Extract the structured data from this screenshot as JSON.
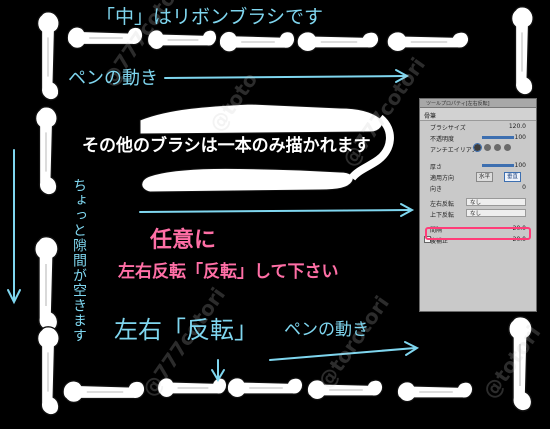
{
  "texts": {
    "title_line": "「中」はリボンブラシです",
    "pen_motion_top": "ペンの動き",
    "other_brush": "その他のブラシは一本のみ描かれます",
    "gap_note": "ちょっと隙間が空きます",
    "optional_1": "任意に",
    "optional_2": "左右反転「反転」して下さい",
    "flip_label": "左右「反転」",
    "pen_motion_bottom": "ペンの動き"
  },
  "watermarks": [
    "@777cotori",
    "@toto",
    "@777cotori",
    "@torotori",
    "@777cotori",
    "@totori"
  ],
  "panel": {
    "window_title": "ツールプロパティ[左右反転]",
    "tool_name": "骨筆",
    "rows": {
      "brush_size": {
        "label": "ブラシサイズ",
        "value": "120.0"
      },
      "opacity": {
        "label": "不透明度",
        "value": "100"
      },
      "antialias": {
        "label": "アンチエイリアス"
      },
      "thickness": {
        "label": "厚さ",
        "value": "100"
      },
      "direction": {
        "label": "適用方向",
        "h": "水平",
        "v": "垂直"
      },
      "orientation": {
        "label": "向き",
        "value": "0"
      },
      "lr_flip": {
        "label": "左右反転",
        "value": "なし"
      },
      "ud_flip": {
        "label": "上下反転",
        "value": "なし"
      },
      "interval": {
        "label": "間隔",
        "value": "20.0"
      },
      "stabilization": {
        "label": "後補正",
        "value": "20.0"
      }
    }
  },
  "colors": {
    "accent_cyan": "#7fd6ef",
    "accent_pink": "#ff6fa6",
    "highlight": "#ff3c78"
  }
}
